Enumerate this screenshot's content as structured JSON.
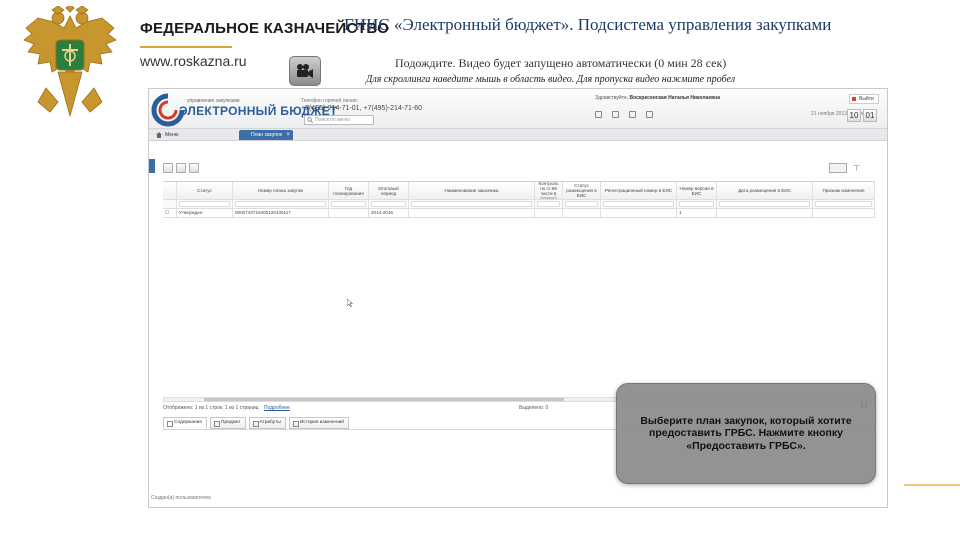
{
  "header": {
    "org_name": "ФЕДЕРАЛЬНОЕ КАЗНАЧЕЙСТВО",
    "org_site": "www.roskazna.ru",
    "title": "ГИИС «Электронный бюджет». Подсистема управления закупками",
    "wait_text": "Подождите. Видео будет запущено автоматически (0 мин 28 сек)",
    "hint_text": "Для скроллинга наведите мышь в область видео. Для пропуска видео нажмите пробел",
    "icons": {
      "emblem": "emblem-icon",
      "video": "video-camera-icon"
    }
  },
  "app": {
    "logo_small": "управление закупками",
    "logo_big": "ЭЛЕКТРОННЫЙ БЮДЖЕТ",
    "phone_label": "Телефон горячей линии:",
    "phones": "+7(495)-214-71-01, +7(495)-214-71-60",
    "search_placeholder": "Поиск по меню",
    "user_label": "Здравствуйте,",
    "user_name": "Воскресенская Наталья Николаевна",
    "exit_label": "Выйти",
    "date_label": "21 ноября 2013\nПятница",
    "clock_hours": "10",
    "clock_minutes": "01",
    "tab_home": "Меню",
    "tab_active": "План закупок",
    "grid": {
      "headers": [
        "",
        "Статус",
        "Номер плана закупок",
        "Год планирования",
        "Итоговый период",
        "Наименование заказчика",
        "Контроль по ст.99 части 5 (статус)",
        "Статус размещения в ЕИС",
        "Регистрационный номер в ЕИС",
        "Номер версии в ЕИС",
        "Дата размещения в ЕИС",
        "Признак изменения"
      ],
      "rows": [
        [
          "",
          "Утвержден",
          "0000743718400120130117",
          "",
          "2014-2016",
          "",
          "",
          "",
          "",
          "1",
          "",
          ""
        ]
      ]
    },
    "pager_text": "Отображено: 1 из 1 строк. 1 из 1 страниц",
    "pager_link": "Подробнее",
    "pager_right": "Выделено: 0",
    "bottom_tabs": [
      "Содержание",
      "Предмет",
      "Атрибуты",
      "История изменений"
    ],
    "status_bar": "Создан(а) пользователем"
  },
  "overlay": {
    "text": "Выберите план закупок, который хотите предоставить ГРБС. Нажмите кнопку «Предоставить ГРБС»."
  }
}
